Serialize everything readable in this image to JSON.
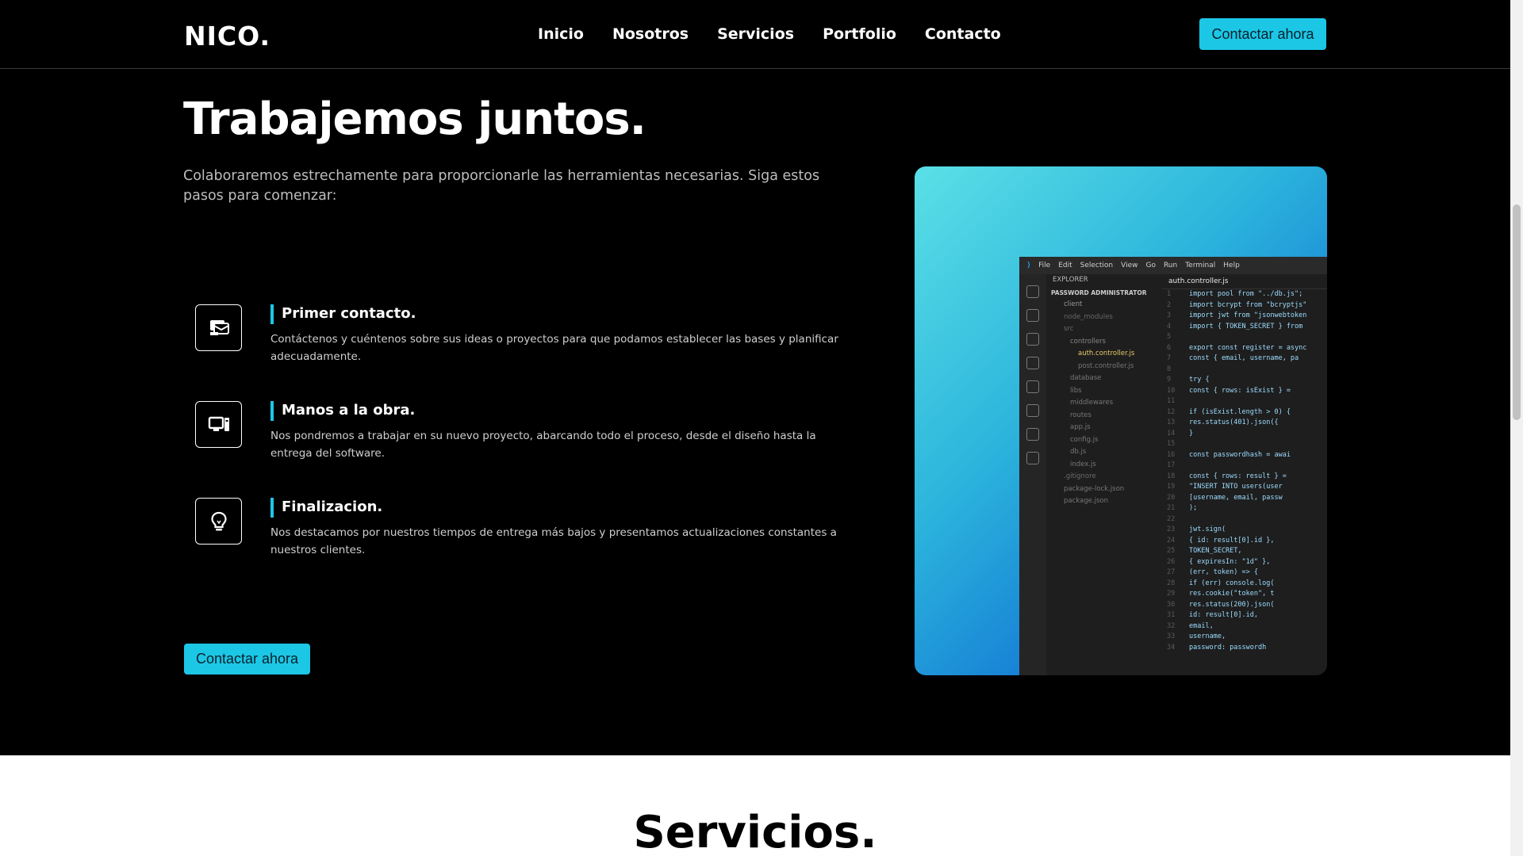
{
  "nav": {
    "logo": "NICO.",
    "links": [
      "Inicio",
      "Nosotros",
      "Servicios",
      "Portfolio",
      "Contacto"
    ],
    "cta": "Contactar ahora"
  },
  "hero": {
    "title": "Trabajemos juntos.",
    "intro": "Colaboraremos estrechamente para proporcionarle las herramientas necesarias. Siga estos pasos para comenzar:",
    "steps": [
      {
        "title": "Primer contacto.",
        "text": "Contáctenos y cuéntenos sobre sus ideas o proyectos para que podamos establecer las bases y planificar adecuadamente.",
        "icon": "message-inbox-icon"
      },
      {
        "title": "Manos a la obra.",
        "text": "Nos pondremos a trabajar en su nuevo proyecto, abarcando todo el proceso, desde el diseño hasta la entrega del software.",
        "icon": "computer-icon"
      },
      {
        "title": "Finalizacion.",
        "text": "Nos destacamos por nuestros tiempos de entrega más bajos y presentamos actualizaciones constantes a nuestros clientes.",
        "icon": "lightbulb-icon"
      }
    ],
    "cta": "Contactar ahora",
    "accent": "#1cc7e6"
  },
  "editor": {
    "menu": [
      "File",
      "Edit",
      "Selection",
      "View",
      "Go",
      "Run",
      "Terminal",
      "Help"
    ],
    "tab": "auth.controller.js",
    "explorer_title": "EXPLORER",
    "explorer": [
      "PASSWORD ADMINISTRATOR",
      "client",
      "node_modules",
      "src",
      "controllers",
      "auth.controller.js",
      "post.controller.js",
      "database",
      "libs",
      "middlewares",
      "routes",
      "app.js",
      "config.js",
      "db.js",
      "index.js",
      ".gitignore",
      "package-lock.json",
      "package.json"
    ],
    "code": [
      "import pool from \"../db.js\";",
      "import bcrypt from \"bcryptjs\"",
      "import jwt from \"jsonwebtoken",
      "import { TOKEN_SECRET } from",
      "",
      "export const register = async",
      "  const { email, username, pa",
      "",
      "  try {",
      "    const { rows: isExist } =",
      "",
      "    if (isExist.length > 0) {",
      "      res.status(401).json({",
      "    }",
      "",
      "    const passwordhash = awai",
      "",
      "    const { rows: result } =",
      "      \"INSERT INTO users(user",
      "      [username, email, passw",
      "    );",
      "",
      "    jwt.sign(",
      "      { id: result[0].id },",
      "      TOKEN_SECRET,",
      "      { expiresIn: \"1d\" },",
      "      (err, token) => {",
      "        if (err) console.log(",
      "        res.cookie(\"token\", t",
      "        res.status(200).json(",
      "          id: result[0].id,",
      "          email,",
      "          username,",
      "          password: passwordh"
    ]
  },
  "services": {
    "title": "Servicios."
  }
}
